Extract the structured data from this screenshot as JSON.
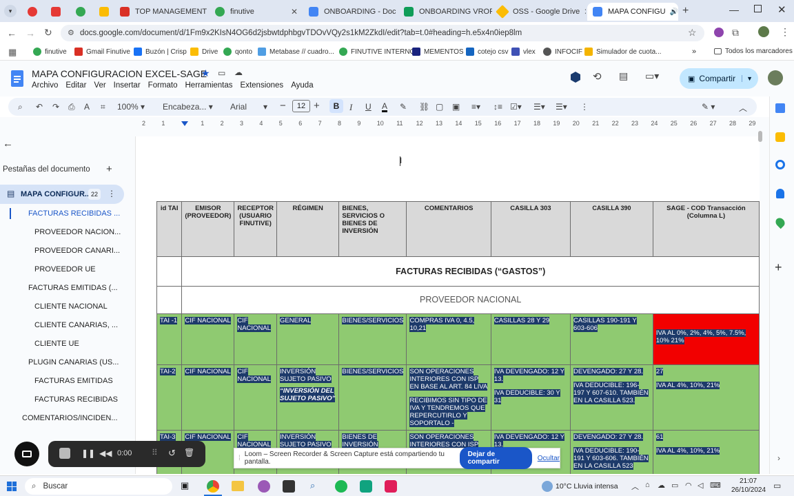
{
  "browser": {
    "tabs": [
      {
        "label": "",
        "color": "#e53935"
      },
      {
        "label": "",
        "color": "#fbbc04"
      },
      {
        "label": "",
        "color": "#34a853"
      },
      {
        "label": "TOP MANAGEMENT",
        "color": "#d93025"
      },
      {
        "label": "finutive",
        "color": "#34a853"
      },
      {
        "label": "ONBOARDING - Doc",
        "color": "#4285f4"
      },
      {
        "label": "ONBOARDING VROF",
        "color": "#0f9d58"
      },
      {
        "label": "OSS - Google Drive",
        "color": "#fbbc04"
      },
      {
        "label": "MAPA CONFIGU",
        "color": "#4285f4"
      }
    ],
    "url": "docs.google.com/document/d/1Fm9x2KIsN4OG6d2jsbwtdphbgvTDOvVQy2s1kM2ZkdI/edit?tab=t.0#heading=h.e5x4n0iep8lm",
    "bookmarks": [
      "finutive",
      "Gmail Finutive",
      "Buzón | Crisp",
      "Drive",
      "qonto",
      "Metabase // cuadro...",
      "FINUTIVE INTERNO",
      "MEMENTOS",
      "cotejo csv",
      "vlex",
      "INFOCIF",
      "Simulador de cuota..."
    ],
    "all_bookmarks": "Todos los marcadores"
  },
  "doc": {
    "title": "MAPA CONFIGURACION EXCEL-SAGE",
    "menus": [
      "Archivo",
      "Editar",
      "Ver",
      "Insertar",
      "Formato",
      "Herramientas",
      "Extensiones",
      "Ayuda"
    ],
    "share_label": "Compartir",
    "zoom": "100%",
    "style": "Encabeza...",
    "font": "Arial",
    "font_size": "12"
  },
  "ruler": [
    "2",
    "1",
    "",
    "1",
    "2",
    "3",
    "4",
    "5",
    "6",
    "7",
    "8",
    "9",
    "10",
    "11",
    "12",
    "13",
    "14",
    "15",
    "16",
    "17",
    "18",
    "19",
    "20",
    "21",
    "22",
    "23",
    "24",
    "25",
    "26",
    "27",
    "28",
    "29"
  ],
  "sidebar": {
    "header": "Pestañas del documento",
    "tab_name": "MAPA CONFIGUR...",
    "tab_count": "22",
    "items": [
      {
        "label": "FACTURAS RECIBIDAS ...",
        "level": 1,
        "active": true
      },
      {
        "label": "PROVEEDOR NACION...",
        "level": 2
      },
      {
        "label": "PROVEEDOR CANARI...",
        "level": 2
      },
      {
        "label": "PROVEEDOR UE",
        "level": 2
      },
      {
        "label": "FACTURAS EMITIDAS (...",
        "level": 1
      },
      {
        "label": "CLIENTE NACIONAL",
        "level": 2
      },
      {
        "label": "CLIENTE CANARIAS, ...",
        "level": 2
      },
      {
        "label": "CLIENTE UE",
        "level": 2
      },
      {
        "label": "PLUGIN CANARIAS (US...",
        "level": 1
      },
      {
        "label": "FACTURAS EMITIDAS",
        "level": 2
      },
      {
        "label": "FACTURAS RECIBIDAS",
        "level": 2
      },
      {
        "label": "COMENTARIOS/INCIDEN...",
        "level": 0
      }
    ]
  },
  "table": {
    "headers": [
      "id TAI",
      "EMISOR (PROVEEDOR)",
      "RECEPTOR (USUARIO FINUTIVE)",
      "RÉGIMEN",
      "BIENES, SERVICIOS O BIENES DE INVERSIÓN",
      "COMENTARIOS",
      "CASILLA 303",
      "CASILLA 390",
      "SAGE - COD Transacción (Columna L)"
    ],
    "section_title": "FACTURAS RECIBIDAS (“GASTOS”)",
    "subsection": "PROVEEDOR NACIONAL",
    "rows": [
      {
        "id": "TAI -1",
        "emisor": "CIF NACIONAL",
        "receptor": "CIF NACIONAL",
        "regimen": "GENERAL",
        "regimen_note": "",
        "bienes": "BIENES/SERVICIOS",
        "comentarios": "COMPRAS IVA 0, 4.5, 10,21",
        "comentarios2": "",
        "c303": "CASILLAS 28 Y 29",
        "c303b": "",
        "c390": "CASILLAS 190-191 Y 603-606",
        "c390b": "",
        "sage": "",
        "sage2": "IVA AL 0%, 2%, 4%, 5%, 7.5%, 10% 21%",
        "sage_color": "#f20000"
      },
      {
        "id": "TAI-2",
        "emisor": "CIF NACIONAL",
        "receptor": "CIF NACIONAL",
        "regimen": "INVERSIÓN SUJETO PASIVO",
        "regimen_note": "“INVERSIÓN DEL SUJETO PASIVO”",
        "bienes": "BIENES/SERVICIOS",
        "comentarios": "SON OPERACIONES INTERIORES CON ISP EN BASE AL ART. 84 LIVA",
        "comentarios2": "RECIBIMOS SIN TIPO DE IVA Y TENDREMOS QUE REPERCUTIRLO Y SOPORTALO -",
        "c303": "IVA DEVENGADO: 12 Y 13.",
        "c303b": "IVA DEDUCIBLE: 30 Y 31",
        "c390": "DEVENGADO: 27 Y 28.",
        "c390b": "IVA DEDUCIBLE: 196-197 Y 607-610. TAMBIÉN EN LA CASILLA 523.",
        "sage": "27",
        "sage2": "IVA AL 4%, 10%, 21%",
        "sage_color": "#8fca71"
      },
      {
        "id": "TAI-3",
        "emisor": "CIF NACIONAL",
        "receptor": "CIF NACIONAL",
        "regimen": "INVERSIÓN SUJETO PASIVO",
        "regimen_note": "",
        "bienes": "BIENES DE INVERSIÓN",
        "comentarios": "SON OPERACIONES INTERIORES CON ISP EN",
        "comentarios2": "",
        "c303": "IVA DEVENGADO: 12 Y 13.",
        "c303b": "",
        "c390": "DEVENGADO: 27 Y 28.",
        "c390b": "IVA DEDUCIBLE: 190-191 Y 603-606. TAMBIÉN EN LA CASILLA 523",
        "sage": "61",
        "sage2": "IVA AL 4%, 10%, 21%",
        "sage_color": "#8fca71"
      }
    ]
  },
  "recorder": {
    "time": "0:00"
  },
  "loom": {
    "message": "Loom – Screen Recorder & Screen Capture está compartiendo tu pantalla.",
    "stop": "Dejar de compartir",
    "hide": "Ocultar"
  },
  "taskbar": {
    "search": "Buscar",
    "weather": "10°C  Lluvia intensa",
    "time": "21:07",
    "date": "26/10/2024"
  }
}
